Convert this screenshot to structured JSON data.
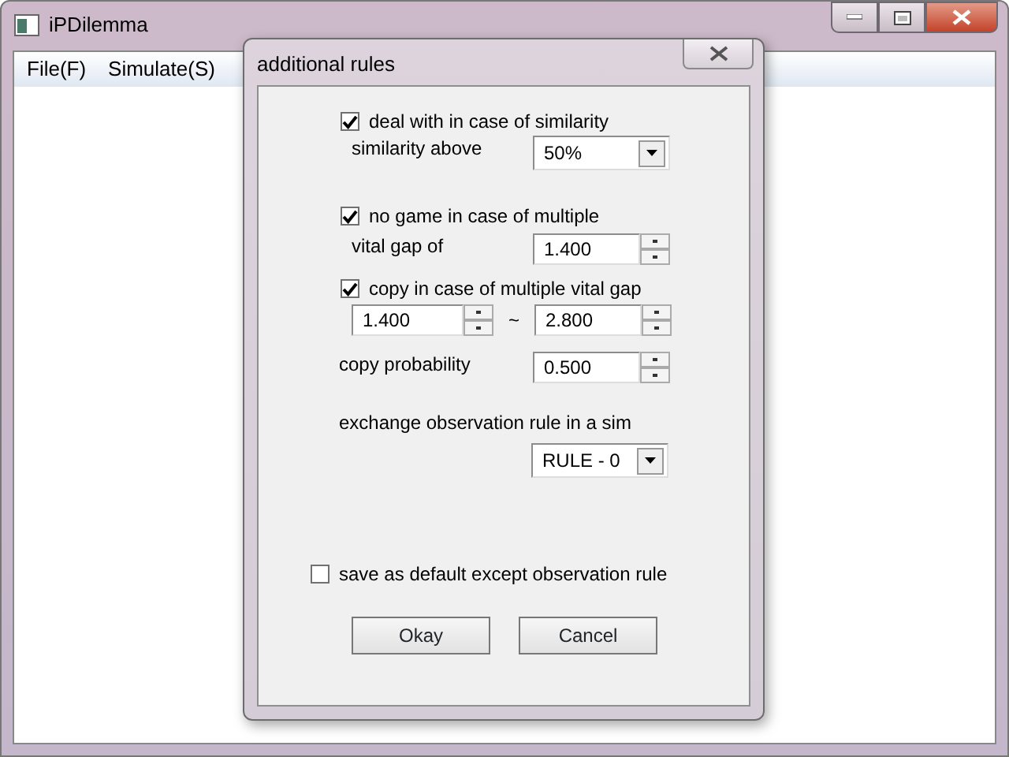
{
  "main_window": {
    "title": "iPDilemma",
    "menu": [
      "File(F)",
      "Simulate(S)"
    ]
  },
  "dialog": {
    "title": "additional rules",
    "similarity": {
      "label": "deal with in case of similarity",
      "checked": true,
      "field_label": "similarity above",
      "value": "50%"
    },
    "no_game": {
      "label": "no game in case of multiple",
      "checked": true,
      "field_label": "vital gap of",
      "value": "1.400"
    },
    "copy": {
      "label": "copy in case of multiple vital gap",
      "checked": true,
      "from": "1.400",
      "separator": "~",
      "to": "2.800"
    },
    "copy_probability": {
      "label": "copy probability",
      "value": "0.500"
    },
    "observation": {
      "label": "exchange observation rule in a sim",
      "value": "RULE - 0"
    },
    "save_default": {
      "label": "save as default except observation rule",
      "checked": false
    },
    "buttons": [
      "Okay",
      "Cancel"
    ]
  }
}
